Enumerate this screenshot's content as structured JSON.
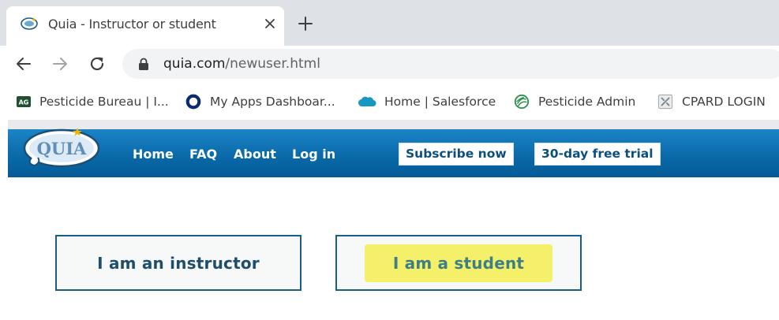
{
  "browser": {
    "tab": {
      "title": "Quia - Instructor or student",
      "favicon": "quia-favicon-icon"
    },
    "address_bar": {
      "domain": "quia.com",
      "path": "/newuser.html"
    },
    "bookmarks": [
      {
        "label": "Pesticide Bureau | I...",
        "icon": "ag-icon"
      },
      {
        "label": "My Apps Dashboar...",
        "icon": "okta-ring-icon"
      },
      {
        "label": "Home | Salesforce",
        "icon": "salesforce-cloud-icon"
      },
      {
        "label": "Pesticide Admin",
        "icon": "leaf-globe-icon"
      },
      {
        "label": "CPARD LOGIN",
        "icon": "tool-icon"
      }
    ]
  },
  "site": {
    "logo_text": "QUIA",
    "nav": [
      "Home",
      "FAQ",
      "About",
      "Log in"
    ],
    "subscribe_label": "Subscribe now",
    "trial_label": "30-day free trial",
    "brand_color": "#0a6aa9"
  },
  "choices": {
    "instructor": "I am an instructor",
    "student": "I am a student",
    "highlight_color": "#f4f06a"
  }
}
